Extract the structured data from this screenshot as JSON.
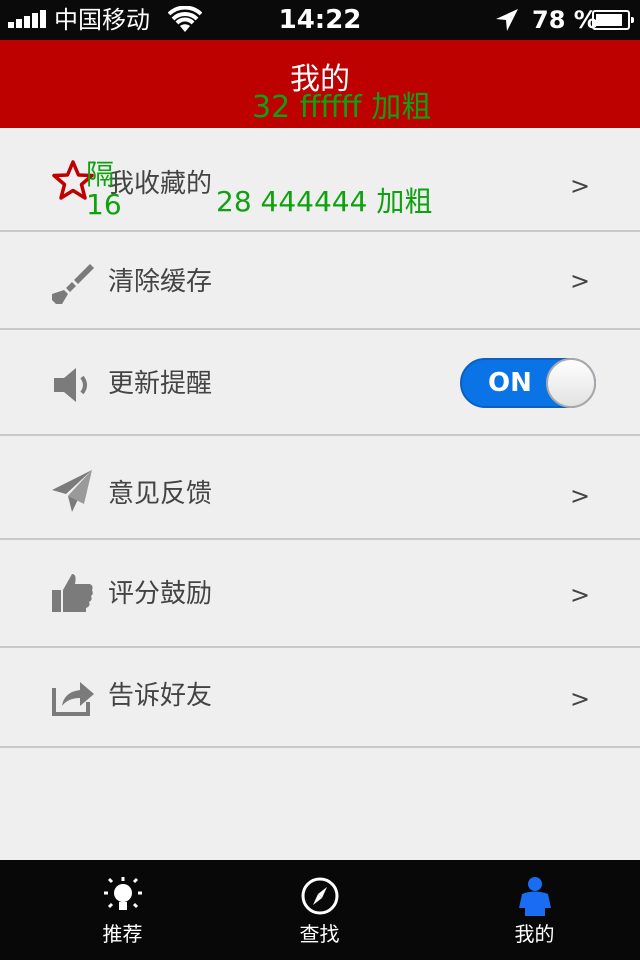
{
  "status_bar": {
    "carrier": "中国移动",
    "time": "14:22",
    "battery_percent": "78 %",
    "battery_level": 0.78
  },
  "nav": {
    "title": "我的",
    "note": "32 ffffff 加粗"
  },
  "menu": {
    "favorites": {
      "label": "我收藏的",
      "arrow": ">",
      "icon": "star-icon",
      "note_left": "隔\n16",
      "note_right": "28 444444 加粗"
    },
    "clear_cache": {
      "label": "清除缓存",
      "arrow": ">",
      "icon": "brush-icon"
    },
    "update_reminder": {
      "label": "更新提醒",
      "icon": "speaker-icon",
      "toggle_text": "ON",
      "toggle_on": true
    },
    "feedback": {
      "label": "意见反馈",
      "arrow": ">",
      "icon": "paper-plane-icon"
    },
    "rate": {
      "label": "评分鼓励",
      "arrow": ">",
      "icon": "thumbs-up-icon"
    },
    "share": {
      "label": "告诉好友",
      "arrow": ">",
      "icon": "share-icon"
    }
  },
  "tabs": [
    {
      "label": "推荐",
      "icon": "lightbulb-icon",
      "active": false
    },
    {
      "label": "查找",
      "icon": "compass-icon",
      "active": false
    },
    {
      "label": "我的",
      "icon": "person-icon",
      "active": true
    }
  ],
  "colors": {
    "nav_bg": "#bd0000",
    "toggle_on": "#0a74e6",
    "active_tab_icon": "#1a6cf0",
    "annotation_green": "#0fa10f",
    "icon_gray": "#7b7b7b"
  }
}
